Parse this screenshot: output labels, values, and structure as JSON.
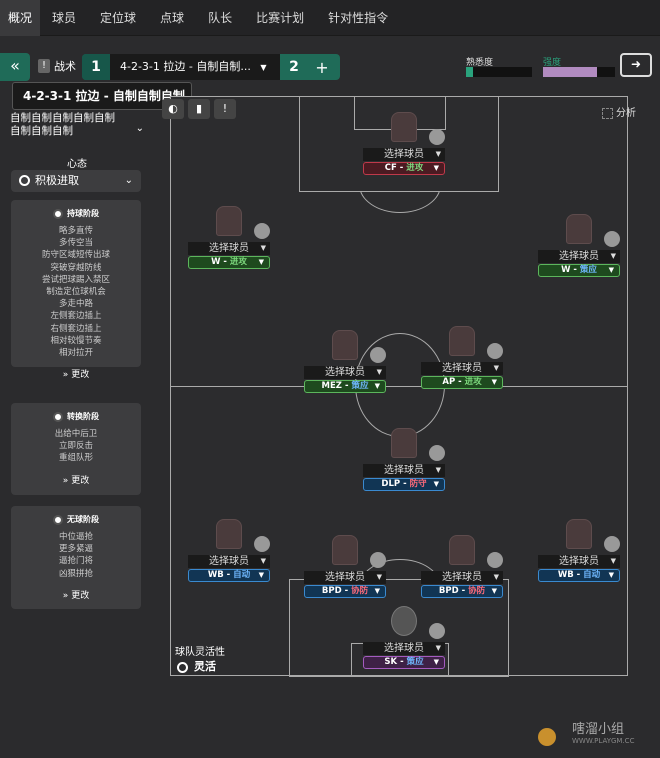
{
  "topnav": {
    "tabs": [
      "概况",
      "球员",
      "定位球",
      "点球",
      "队长",
      "比赛计划",
      "针对性指令"
    ]
  },
  "toolbar": {
    "back": "«",
    "tactic_label": "战术",
    "slot1": "1",
    "tactic_name": "4-2-3-1 拉边 - 自制自制...",
    "slot2": "2",
    "add": "+"
  },
  "tooltip": "4-2-3-1 拉边 - 自制自制自制",
  "familiarity": {
    "label": "熟悉度",
    "fill": 0.1
  },
  "tab2": {
    "label": "强度",
    "fill": 0.75
  },
  "style_name": "自制自制自制自制自制自制自制自制",
  "mentality": {
    "label": "心态",
    "value": "积极进取"
  },
  "phases": [
    {
      "title": "持球阶段",
      "items": [
        "略多直传",
        "多传空当",
        "防守区域短传出球",
        "突破穿越防线",
        "尝试把球踢入禁区",
        "制造定位球机会",
        "多走中路",
        "左侧套边插上",
        "右侧套边插上",
        "相对较慢节奏",
        "相对拉开"
      ],
      "more": "更改"
    },
    {
      "title": "转换阶段",
      "items": [
        "出给中后卫",
        "立即反击",
        "重组队形"
      ],
      "more": "更改"
    },
    {
      "title": "无球阶段",
      "items": [
        "中位逼抢",
        "更多紧逼",
        "逼抢门将",
        "凶狠拼抢"
      ],
      "more": "更改"
    }
  ],
  "analysis": "分析",
  "players": [
    {
      "select": "选择球员",
      "role": "CF",
      "duty": "进攻"
    },
    {
      "select": "选择球员",
      "role": "W",
      "duty": "进攻"
    },
    {
      "select": "选择球员",
      "role": "W",
      "duty": "策应"
    },
    {
      "select": "选择球员",
      "role": "MEZ",
      "duty": "策应"
    },
    {
      "select": "选择球员",
      "role": "AP",
      "duty": "进攻"
    },
    {
      "select": "选择球员",
      "role": "DLP",
      "duty": "防守"
    },
    {
      "select": "选择球员",
      "role": "WB",
      "duty": "自动"
    },
    {
      "select": "选择球员",
      "role": "BPD",
      "duty": "协防"
    },
    {
      "select": "选择球员",
      "role": "BPD",
      "duty": "协防"
    },
    {
      "select": "选择球员",
      "role": "WB",
      "duty": "自动"
    },
    {
      "select": "选择球员",
      "role": "SK",
      "duty": "策应"
    }
  ],
  "flex": {
    "label": "球队灵活性",
    "value": "灵活"
  },
  "watermark": {
    "title": "嗐溜小组",
    "site": "WWW.PLAYGM.CC"
  }
}
